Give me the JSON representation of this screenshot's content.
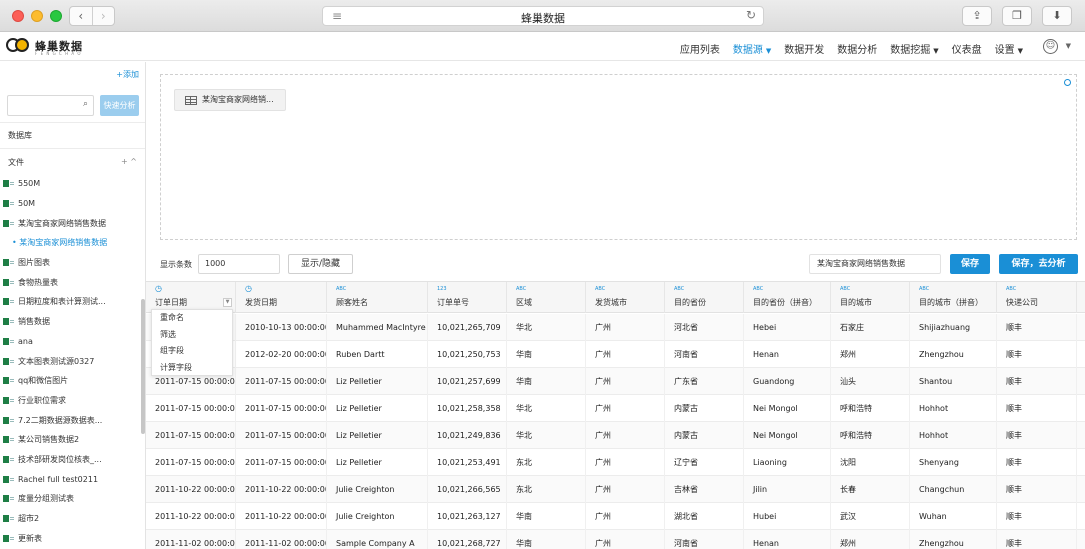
{
  "browser": {
    "title": "蜂巢数据",
    "back": "‹",
    "forward": "›"
  },
  "brand": {
    "name": "蜂巢数据",
    "tagline": "F E N G C H A O"
  },
  "nav": {
    "items": [
      {
        "label": "应用列表",
        "caret": false,
        "active": false
      },
      {
        "label": "数据源",
        "caret": true,
        "active": true
      },
      {
        "label": "数据开发",
        "caret": false,
        "active": false
      },
      {
        "label": "数据分析",
        "caret": false,
        "active": false
      },
      {
        "label": "数据挖掘",
        "caret": true,
        "active": false
      },
      {
        "label": "仪表盘",
        "caret": false,
        "active": false
      },
      {
        "label": "设置",
        "caret": true,
        "active": false
      }
    ]
  },
  "sidebar": {
    "add_label": "+添加",
    "search_placeholder": "",
    "quick_analysis": "快速分析",
    "database_label": "数据库",
    "files_label": "文件",
    "files_ctrl": "+ ^",
    "files": [
      {
        "label": "550M",
        "selected": false
      },
      {
        "label": "50M",
        "selected": false
      },
      {
        "label": "某淘宝商家网络销售数据",
        "selected": false
      },
      {
        "label": "• 某淘宝商家网络销售数据",
        "selected": true
      },
      {
        "label": "图片图表",
        "selected": false
      },
      {
        "label": "食物热量表",
        "selected": false
      },
      {
        "label": "日期粒度和表计算测试...",
        "selected": false
      },
      {
        "label": "销售数据",
        "selected": false
      },
      {
        "label": "ana",
        "selected": false
      },
      {
        "label": "文本图表测试源0327",
        "selected": false
      },
      {
        "label": "qq和微信图片",
        "selected": false
      },
      {
        "label": "行业职位需求",
        "selected": false
      },
      {
        "label": "7.2二期数据源数据表...",
        "selected": false
      },
      {
        "label": "某公司销售数据2",
        "selected": false
      },
      {
        "label": "技术部研发岗位核表_...",
        "selected": false
      },
      {
        "label": "Rachel full test0211",
        "selected": false
      },
      {
        "label": "度量分组测试表",
        "selected": false
      },
      {
        "label": "超市2",
        "selected": false
      },
      {
        "label": "更新表",
        "selected": false
      }
    ]
  },
  "canvas": {
    "table_chip": "某淘宝商家网络销..."
  },
  "toolbar": {
    "rows_label": "显示条数",
    "rows_value": "1000",
    "toggle_label": "显示/隐藏",
    "dataset_name": "某淘宝商家网络销售数据",
    "save_label": "保存",
    "save_analyze_label": "保存，去分析"
  },
  "grid": {
    "columns": [
      {
        "type": "clock",
        "name": "订单日期",
        "dropdown": true
      },
      {
        "type": "clock",
        "name": "发货日期",
        "dropdown": false
      },
      {
        "type": "ABC",
        "name": "顾客姓名",
        "dropdown": false
      },
      {
        "type": "123",
        "name": "订单单号",
        "dropdown": false
      },
      {
        "type": "ABC",
        "name": "区域",
        "dropdown": false
      },
      {
        "type": "ABC",
        "name": "发货城市",
        "dropdown": false
      },
      {
        "type": "ABC",
        "name": "目的省份",
        "dropdown": false
      },
      {
        "type": "ABC",
        "name": "目的省份（拼音）",
        "dropdown": false
      },
      {
        "type": "ABC",
        "name": "目的城市",
        "dropdown": false
      },
      {
        "type": "ABC",
        "name": "目的城市（拼音）",
        "dropdown": false
      },
      {
        "type": "ABC",
        "name": "快递公司",
        "dropdown": false
      }
    ],
    "rows": [
      [
        "",
        "2010-10-13 00:00:00",
        "Muhammed MacIntyre",
        "10,021,265,709",
        "华北",
        "广州",
        "河北省",
        "Hebei",
        "石家庄",
        "Shijiazhuang",
        "顺丰"
      ],
      [
        "",
        "2012-02-20 00:00:00",
        "Ruben Dartt",
        "10,021,250,753",
        "华南",
        "广州",
        "河南省",
        "Henan",
        "郑州",
        "Zhengzhou",
        "顺丰"
      ],
      [
        "2011-07-15 00:00:00",
        "2011-07-15 00:00:00",
        "Liz Pelletier",
        "10,021,257,699",
        "华南",
        "广州",
        "广东省",
        "Guandong",
        "汕头",
        "Shantou",
        "顺丰"
      ],
      [
        "2011-07-15 00:00:00",
        "2011-07-15 00:00:00",
        "Liz Pelletier",
        "10,021,258,358",
        "华北",
        "广州",
        "内蒙古",
        "Nei Mongol",
        "呼和浩特",
        "Hohhot",
        "顺丰"
      ],
      [
        "2011-07-15 00:00:00",
        "2011-07-15 00:00:00",
        "Liz Pelletier",
        "10,021,249,836",
        "华北",
        "广州",
        "内蒙古",
        "Nei Mongol",
        "呼和浩特",
        "Hohhot",
        "顺丰"
      ],
      [
        "2011-07-15 00:00:00",
        "2011-07-15 00:00:00",
        "Liz Pelletier",
        "10,021,253,491",
        "东北",
        "广州",
        "辽宁省",
        "Liaoning",
        "沈阳",
        "Shenyang",
        "顺丰"
      ],
      [
        "2011-10-22 00:00:00",
        "2011-10-22 00:00:00",
        "Julie Creighton",
        "10,021,266,565",
        "东北",
        "广州",
        "吉林省",
        "Jilin",
        "长春",
        "Changchun",
        "顺丰"
      ],
      [
        "2011-10-22 00:00:00",
        "2011-10-22 00:00:00",
        "Julie Creighton",
        "10,021,263,127",
        "华南",
        "广州",
        "湖北省",
        "Hubei",
        "武汉",
        "Wuhan",
        "顺丰"
      ],
      [
        "2011-11-02 00:00:00",
        "2011-11-02 00:00:00",
        "Sample Company A",
        "10,021,268,727",
        "华南",
        "广州",
        "河南省",
        "Henan",
        "郑州",
        "Zhengzhou",
        "顺丰"
      ]
    ]
  },
  "context_menu": {
    "items": [
      "重命名",
      "筛选",
      "组字段",
      "计算字段"
    ]
  },
  "colors": {
    "accent": "#1a8fd6",
    "quick_btn": "#9bcdee",
    "excel_icon": "#1e7e45"
  }
}
